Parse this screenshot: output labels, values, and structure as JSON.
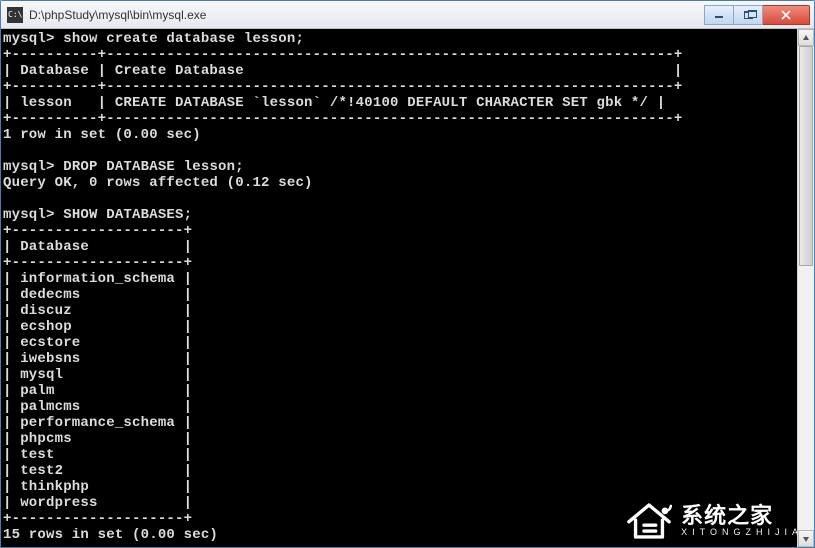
{
  "window": {
    "title": "D:\\phpStudy\\mysql\\bin\\mysql.exe"
  },
  "terminal": {
    "prompt": "mysql>",
    "cmd1": "show create database lesson;",
    "border1_top": "+----------+------------------------------------------------------------------+",
    "header1": "| Database | Create Database                                                  |",
    "border1_mid": "+----------+------------------------------------------------------------------+",
    "row1": "| lesson   | CREATE DATABASE `lesson` /*!40100 DEFAULT CHARACTER SET gbk */ |",
    "border1_bot": "+----------+------------------------------------------------------------------+",
    "result1": "1 row in set (0.00 sec)",
    "cmd2": "DROP DATABASE lesson;",
    "result2": "Query OK, 0 rows affected (0.12 sec)",
    "cmd3": "SHOW DATABASES;",
    "border2_top": "+--------------------+",
    "header2": "| Database           |",
    "border2_mid": "+--------------------+",
    "db": [
      "| information_schema |",
      "| dedecms            |",
      "| discuz             |",
      "| ecshop             |",
      "| ecstore            |",
      "| iwebsns            |",
      "| mysql              |",
      "| palm               |",
      "| palmcms            |",
      "| performance_schema |",
      "| phpcms             |",
      "| test               |",
      "| test2              |",
      "| thinkphp           |",
      "| wordpress          |"
    ],
    "border2_bot": "+--------------------+",
    "result3": "15 rows in set (0.00 sec)"
  },
  "logo": {
    "main": "系统之家",
    "sub": "XITONGZHIJIA"
  }
}
